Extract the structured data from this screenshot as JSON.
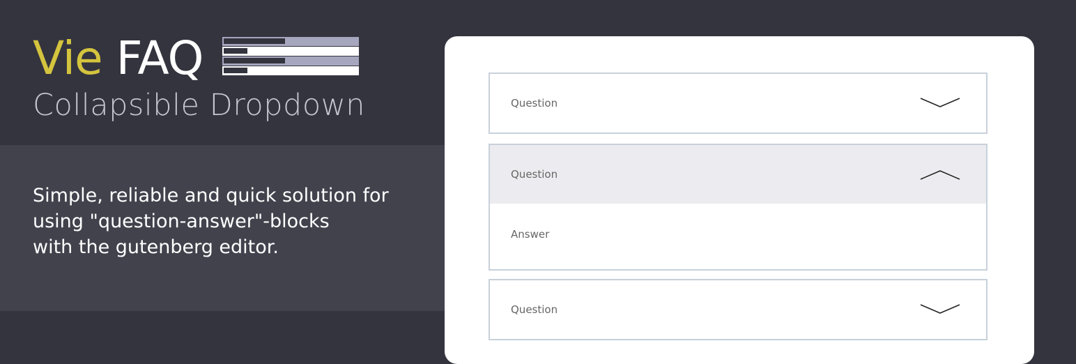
{
  "brand": {
    "title_part1": "Vie",
    "title_part2": "FAQ",
    "subtitle": "Collapsible Dropdown",
    "accent_color": "#d4c43e",
    "icon": "faq-list-icon"
  },
  "description": {
    "lines": [
      "Simple, reliable and quick solution for",
      "using \"question-answer\"-blocks",
      "with the gutenberg editor."
    ]
  },
  "faq": {
    "items": [
      {
        "question": "Question",
        "state": "collapsed",
        "icon": "chevron-down-icon"
      },
      {
        "question": "Question",
        "answer": "Answer",
        "state": "expanded",
        "icon": "chevron-up-icon"
      },
      {
        "question": "Question",
        "state": "collapsed",
        "icon": "chevron-down-icon"
      }
    ]
  }
}
